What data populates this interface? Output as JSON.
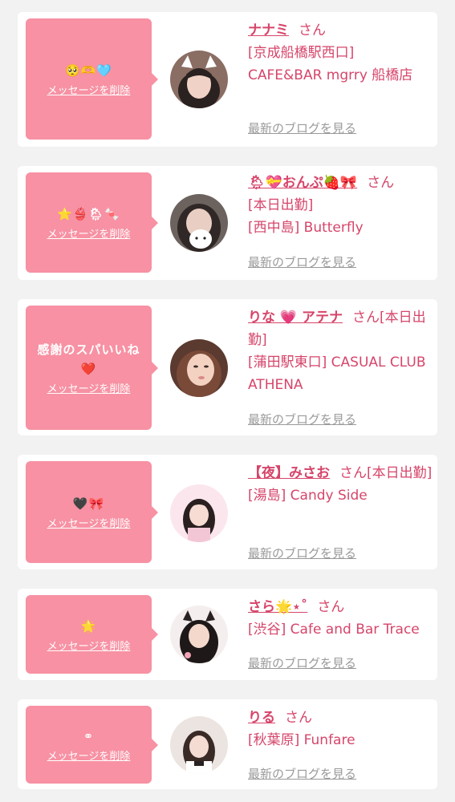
{
  "colors": {
    "bubble": "#f791a3",
    "accent": "#d6456a",
    "muted": "#9a9a9a"
  },
  "cards": [
    {
      "message": "🥺🫶🩵",
      "delete_label": "メッセージを削除",
      "name": "ナナミ",
      "san": "さん",
      "location": "[京成船橋駅西口] CAFE&BAR mgrry 船橋店",
      "blog_label": "最新のブログを見る"
    },
    {
      "message": "⭐👙🌦🍬",
      "delete_label": "メッセージを削除",
      "name": "🌦💝おんぷ🍓🎀",
      "san": "さん",
      "location": "[本日出勤]",
      "location2": "[西中島] Butterfly",
      "blog_label": "最新のブログを見る"
    },
    {
      "message": "感謝のスパいいね",
      "message2": "❤️",
      "delete_label": "メッセージを削除",
      "name": "りな 💗 アテナ",
      "san": "さん",
      "location": "[本日出勤]",
      "location2": "[蒲田駅東口] CASUAL CLUB ATHENA",
      "blog_label": "最新のブログを見る"
    },
    {
      "message": "🖤🎀",
      "delete_label": "メッセージを削除",
      "name": "【夜】みさお",
      "san": "さん",
      "location": "[本日出勤]",
      "location2": "[湯島] Candy Side",
      "blog_label": "最新のブログを見る"
    },
    {
      "message": "🌟",
      "delete_label": "メッセージを削除",
      "name": "さら🌟⋆˚",
      "san": "さん",
      "location": "[渋谷] Cafe and Bar Trace",
      "blog_label": "最新のブログを見る"
    },
    {
      "message": "⚭",
      "delete_label": "メッセージを削除",
      "name": "りる",
      "san": "さん",
      "location": "[秋葉原] Funfare",
      "blog_label": "最新のブログを見る"
    }
  ]
}
